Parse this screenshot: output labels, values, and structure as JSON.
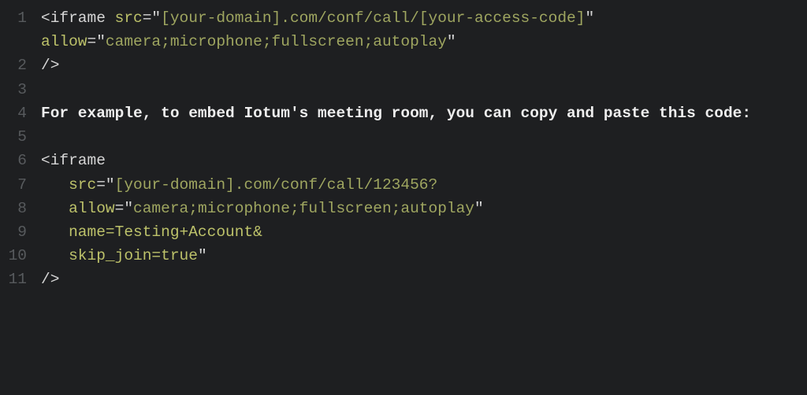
{
  "lines": {
    "n1": "1",
    "n2": "2",
    "n3": "3",
    "n4": "4",
    "n5": "5",
    "n6": "6",
    "n7": "7",
    "n8": "8",
    "n9": "9",
    "n10": "10",
    "n11": "11"
  },
  "l1": {
    "a": "<",
    "b": "iframe",
    "c": " ",
    "d": "src",
    "e": "=\"",
    "f": "[your-domain].com/conf/call/[your-access-code]",
    "g": "\" ",
    "h": "allow",
    "i": "=\"",
    "j": "camera;microphone;fullscreen;autoplay",
    "k": "\""
  },
  "l2": {
    "a": "/>"
  },
  "l4": {
    "a": "For example, to embed Iotum's meeting room, you can copy and paste this code:"
  },
  "l6": {
    "a": "<",
    "b": "iframe"
  },
  "l7": {
    "pad": "   ",
    "a": "src",
    "b": "=\"",
    "c": "[your-domain].com/conf/call/123456?"
  },
  "l8": {
    "pad": "   ",
    "a": "allow",
    "b": "=\"",
    "c": "camera;microphone;fullscreen;autoplay",
    "d": "\""
  },
  "l9": {
    "pad": "   ",
    "a": "name=Testing+Account&"
  },
  "l10": {
    "pad": "   ",
    "a": "skip_join=true",
    "q": "\""
  },
  "l11": {
    "a": "/>"
  }
}
